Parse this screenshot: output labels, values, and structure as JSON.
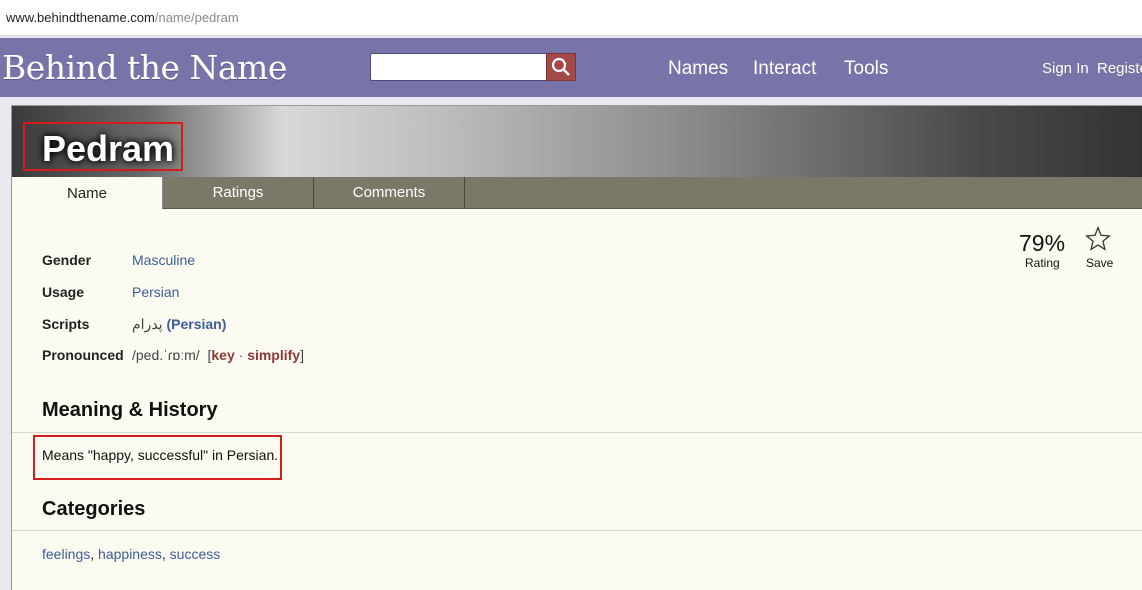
{
  "url": {
    "domain": "www.behindthename.com",
    "path": "/name/pedram"
  },
  "header": {
    "logo": "Behind the Name",
    "search": {
      "placeholder": "",
      "button_icon": "search-icon"
    },
    "nav": [
      "Names",
      "Interact",
      "Tools"
    ],
    "sign_in": "Sign In",
    "register": "Registe"
  },
  "name": {
    "title": "Pedram",
    "tabs": [
      "Name",
      "Ratings",
      "Comments"
    ],
    "active_tab": "Name",
    "rating": {
      "value": "79%",
      "label": "Rating"
    },
    "save": {
      "label": "Save",
      "icon": "star-outline-icon"
    },
    "info": {
      "gender": {
        "label": "Gender",
        "value": "Masculine"
      },
      "usage": {
        "label": "Usage",
        "value": "Persian"
      },
      "scripts": {
        "label": "Scripts",
        "script_text": "پدرام",
        "script_lang": "(Persian)"
      },
      "pronounced": {
        "label": "Pronounced",
        "ipa": "/ped.ˈɾɒːm/",
        "open": "[",
        "key": "key",
        "dot": "·",
        "simplify": "simplify",
        "close": "]"
      }
    },
    "meaning": {
      "heading": "Meaning & History",
      "text": "Means \"happy, successful\" in Persian."
    },
    "categories": {
      "heading": "Categories",
      "items": [
        "feelings",
        "happiness",
        "success"
      ],
      "sep": ","
    }
  },
  "colors": {
    "header_bg": "#7674a8",
    "search_btn": "#a44848",
    "tab_bar": "#7a7866",
    "highlight_box": "#d21e1e",
    "link": "#3d5d99"
  }
}
